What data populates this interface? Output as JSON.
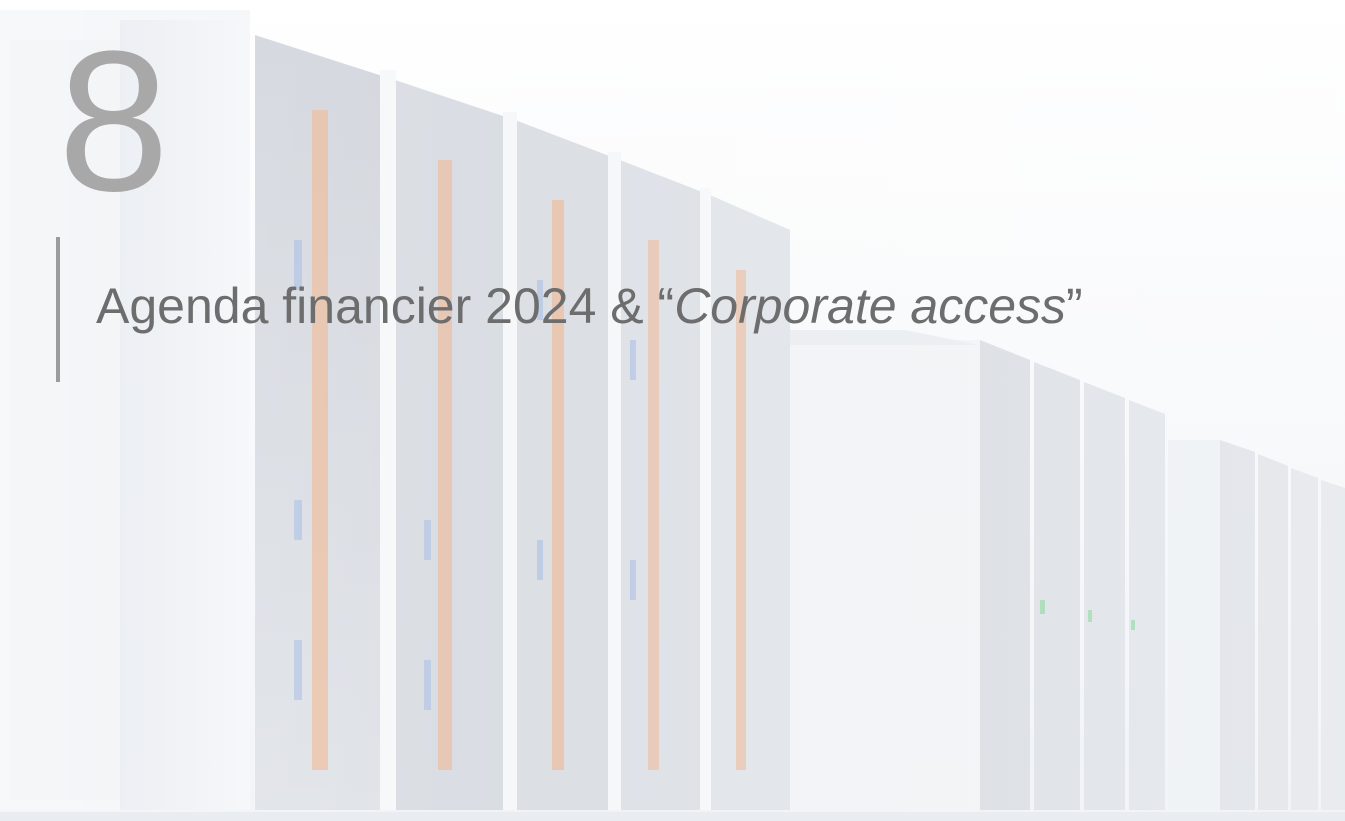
{
  "slide": {
    "section_number": "8",
    "title": {
      "prefix": "Agenda financier 2024 & “",
      "emphasis": "Corporate access",
      "suffix": "”"
    }
  },
  "colors": {
    "number": "#a8a8a8",
    "title": "#6d6d6d",
    "rule": "#9b9b9b",
    "rack_accent_orange": "#f2a06a",
    "rack_accent_blue": "#7f9fe0",
    "rack_led_green": "#6fd08a"
  },
  "background": {
    "icon": "server-racks-photo"
  }
}
